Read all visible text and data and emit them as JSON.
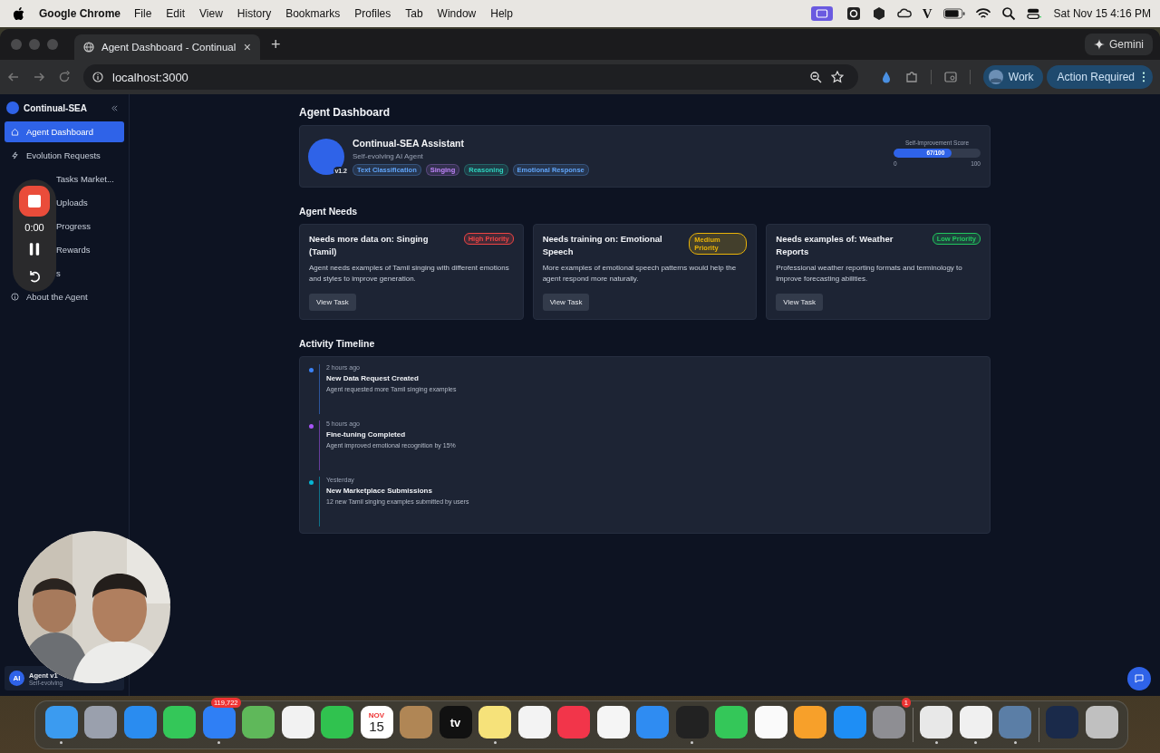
{
  "menubar": {
    "app": "Google Chrome",
    "menus": [
      "File",
      "Edit",
      "View",
      "History",
      "Bookmarks",
      "Profiles",
      "Tab",
      "Window",
      "Help"
    ],
    "status_letter": "V",
    "clock": "Sat Nov 15  4:16 PM"
  },
  "browser": {
    "tab_title": "Agent Dashboard - Continual",
    "tab_close": "×",
    "new_tab": "+",
    "gemini": "Gemini",
    "url": "localhost:3000",
    "profile": "Work",
    "action": "Action Required"
  },
  "sidebar": {
    "brand": "Continual-SEA",
    "items": [
      {
        "label": "Agent Dashboard",
        "selected": true
      },
      {
        "label": "Evolution Requests",
        "selected": false
      },
      {
        "label": "Tasks Market...",
        "selected": false
      },
      {
        "label": "Uploads",
        "selected": false
      },
      {
        "label": "Progress",
        "selected": false
      },
      {
        "label": "Rewards",
        "selected": false
      },
      {
        "label": "s",
        "selected": false
      },
      {
        "label": "About the Agent",
        "selected": false
      }
    ],
    "footer": {
      "avatar": "AI",
      "name": "Agent v1",
      "subtitle": "Self-evolving"
    }
  },
  "recorder": {
    "time": "0:00"
  },
  "dashboard": {
    "heading": "Agent Dashboard",
    "agent": {
      "name": "Continual-SEA Assistant",
      "subtitle": "Self-evolving AI Agent",
      "version": "v1.2",
      "tags": [
        {
          "label": "Text Classification",
          "color": "#60a5fa"
        },
        {
          "label": "Singing",
          "color": "#c084fc"
        },
        {
          "label": "Reasoning",
          "color": "#2dd4bf"
        },
        {
          "label": "Emotional Response",
          "color": "#60a5fa"
        }
      ],
      "score_label": "Self-Improvement Score",
      "score": {
        "level": 0.67,
        "reading": "67/100"
      },
      "score_min": "0",
      "score_max": "100"
    }
  },
  "needs": {
    "heading": "Agent Needs",
    "cards": [
      {
        "title": "Needs more data on: Singing (Tamil)",
        "color": "#ef4444",
        "priority_label": "High Priority",
        "text": "Agent needs examples of Tamil singing with different emotions and styles to improve generation.",
        "button": "View Task"
      },
      {
        "title": "Needs training on: Emotional Speech",
        "color": "#eab308",
        "priority_label": "Medium Priority",
        "text": "More examples of emotional speech patterns would help the agent respond more naturally.",
        "button": "View Task"
      },
      {
        "title": "Needs examples of: Weather Reports",
        "color": "#22c55e",
        "priority_label": "Low Priority",
        "text": "Professional weather reporting formats and terminology to improve forecasting abilities.",
        "button": "View Task"
      }
    ]
  },
  "timeline": {
    "heading": "Activity Timeline",
    "events": [
      {
        "time": "2 hours ago",
        "title": "New Data Request Created",
        "text": "Agent requested more Tamil singing examples",
        "color": "#3b82f6"
      },
      {
        "time": "5 hours ago",
        "title": "Fine-tuning Completed",
        "text": "Agent improved emotional recognition by 15%",
        "color": "#a855f7"
      },
      {
        "time": "Yesterday",
        "title": "New Marketplace Submissions",
        "text": "12 new Tamil singing examples submitted by users",
        "color": "#06b6d4"
      }
    ]
  },
  "dock": [
    {
      "color": "#3b9bf0",
      "running": true
    },
    {
      "color": "#9aa0ad",
      "running": false
    },
    {
      "color": "#2a8cf0",
      "running": false
    },
    {
      "color": "#34c759",
      "running": false
    },
    {
      "color": "#2f7ff5",
      "running": true,
      "badge": "119,722"
    },
    {
      "color": "#5fb85a",
      "running": false
    },
    {
      "color": "#f2f2f2",
      "running": false
    },
    {
      "color": "#30c24f",
      "running": false
    },
    {
      "color": "#ffffff",
      "running": false,
      "month": "NOV",
      "day": "15"
    },
    {
      "color": "#b08655",
      "running": false
    },
    {
      "color": "#111111",
      "running": false,
      "text": "tv"
    },
    {
      "color": "#f6e27a",
      "running": true
    },
    {
      "color": "#f3f3f3",
      "running": false
    },
    {
      "color": "#f2354a",
      "running": false
    },
    {
      "color": "#f5f5f5",
      "running": false
    },
    {
      "color": "#2f8cf2",
      "running": false
    },
    {
      "color": "#222222",
      "running": true
    },
    {
      "color": "#34c759",
      "running": false
    },
    {
      "color": "#fafafa",
      "running": false
    },
    {
      "color": "#f7a02a",
      "running": false
    },
    {
      "color": "#1e8ef5",
      "running": false
    },
    {
      "color": "#8e8e93",
      "running": false,
      "badge": "1"
    },
    {
      "color": "#e8e8e8",
      "running": true,
      "separator": true
    },
    {
      "color": "#f0f0f0",
      "running": true
    },
    {
      "color": "#5b7ea6",
      "running": true
    },
    {
      "color": "#1a2a4a",
      "running": false,
      "separator": true
    },
    {
      "color": "#c0c0c0",
      "running": false
    }
  ]
}
